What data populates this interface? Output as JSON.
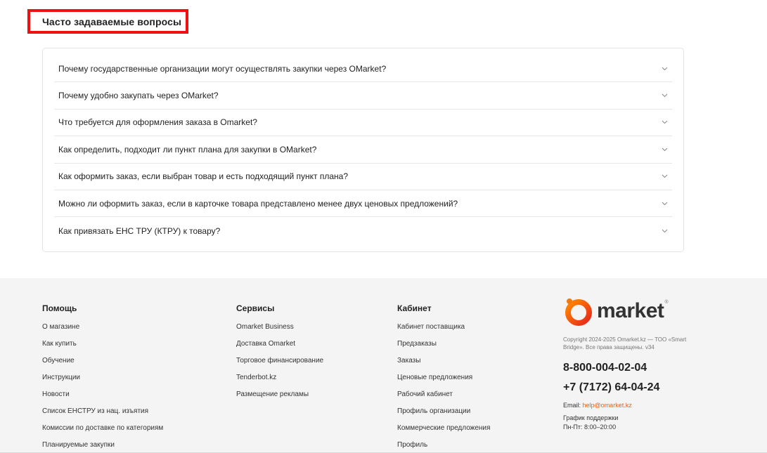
{
  "faq": {
    "title": "Часто задаваемые вопросы",
    "questions": [
      "Почему государственные организации могут осуществлять закупки через OMarket?",
      "Почему удобно закупать через OMarket?",
      "Что требуется для оформления заказа в Omarket?",
      "Как определить, подходит ли пункт плана для закупки в OMarket?",
      "Как оформить заказ, если выбран товар и есть подходящий пункт плана?",
      "Можно ли оформить заказ, если в карточке товара представлено менее двух ценовых предложений?",
      "Как привязать ЕНС ТРУ (КТРУ) к товару?"
    ]
  },
  "footer": {
    "help": {
      "heading": "Помощь",
      "links": [
        "О магазине",
        "Как купить",
        "Обучение",
        "Инструкции",
        "Новости",
        "Список ЕНСТРУ из нац. изъятия",
        "Комиссии по доставке по категориям",
        "Планируемые закупки"
      ]
    },
    "services": {
      "heading": "Сервисы",
      "links": [
        "Omarket Business",
        "Доставка Omarket",
        "Торговое финансирование",
        "Tenderbot.kz",
        "Размещение рекламы"
      ]
    },
    "cabinet": {
      "heading": "Кабинет",
      "links": [
        "Кабинет поставщика",
        "Предзаказы",
        "Заказы",
        "Ценовые предложения",
        "Рабочий кабинет",
        "Профиль организации",
        "Коммерческие предложения",
        "Профиль"
      ]
    },
    "brand": {
      "logo_text": "market",
      "copyright": "Copyright 2024-2025 Omarket.kz — ТОО «Smart Bridge». Все права защищены. v34",
      "phone1": "8-800-004-02-04",
      "phone2": "+7 (7172) 64-04-24",
      "email_label": "Email:",
      "email": "help@omarket.kz",
      "support_title": "График поддержки",
      "support_hours": "Пн-Пт: 8:00–20:00"
    }
  },
  "colors": {
    "accent": "#e8601c",
    "highlight_border": "#ee1111"
  }
}
